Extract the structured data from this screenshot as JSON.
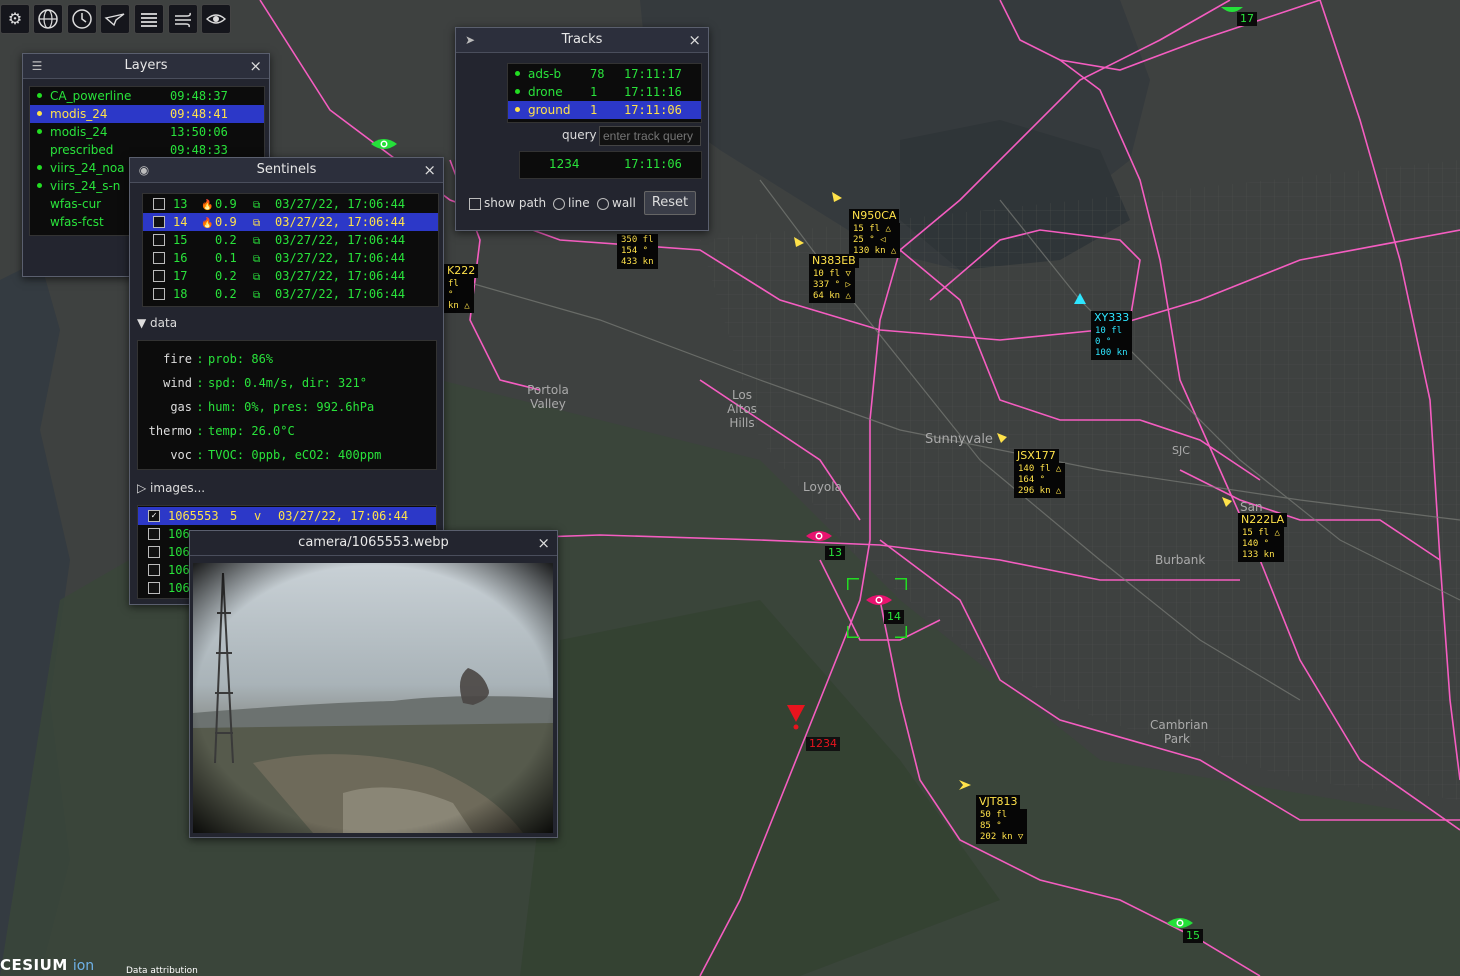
{
  "colors": {
    "accent": "#2c38c8",
    "green_text": "#29e33b",
    "yellow_text": "#ffe24a",
    "cyan_text": "#2ee6ff",
    "powerline": "#ff5fc8",
    "fire_red": "#e8141e"
  },
  "toolbar": {
    "icons": [
      "gear-icon",
      "globe-icon",
      "clock-icon",
      "plane-icon",
      "layers-icon",
      "wind-icon",
      "eye-icon"
    ]
  },
  "layers": {
    "title": "Layers",
    "items": [
      {
        "name": "CA_powerline",
        "time": "09:48:37",
        "dot": "green",
        "selected": false
      },
      {
        "name": "modis_24",
        "time": "09:48:41",
        "dot": "yellow",
        "selected": true
      },
      {
        "name": "modis_24",
        "time": "13:50:06",
        "dot": "green",
        "selected": false
      },
      {
        "name": "prescribed",
        "time": "09:48:33",
        "dot": "none",
        "selected": false
      },
      {
        "name": "viirs_24_noa",
        "time": "",
        "dot": "green",
        "selected": false
      },
      {
        "name": "viirs_24_s-n",
        "time": "",
        "dot": "green",
        "selected": false
      },
      {
        "name": "wfas-cur",
        "time": "",
        "dot": "none",
        "selected": false
      },
      {
        "name": "wfas-fcst",
        "time": "",
        "dot": "none",
        "selected": false
      }
    ]
  },
  "tracks": {
    "title": "Tracks",
    "items": [
      {
        "name": "ads-b",
        "count": "78",
        "time": "17:11:17",
        "selected": false
      },
      {
        "name": "drone",
        "count": "1",
        "time": "17:11:16",
        "selected": false
      },
      {
        "name": "ground",
        "count": "1",
        "time": "17:11:06",
        "selected": true
      }
    ],
    "query_label": "query",
    "query_placeholder": "enter track query",
    "result": {
      "id": "1234",
      "time": "17:11:06"
    },
    "show_path": "show path",
    "line": "line",
    "wall": "wall",
    "reset": "Reset"
  },
  "sentinels": {
    "title": "Sentinels",
    "items": [
      {
        "id": "13",
        "fire": true,
        "value": "0.9",
        "date": "03/27/22, 17:06:44",
        "selected": false
      },
      {
        "id": "14",
        "fire": true,
        "value": "0.9",
        "date": "03/27/22, 17:06:44",
        "selected": true
      },
      {
        "id": "15",
        "fire": false,
        "value": "0.2",
        "date": "03/27/22, 17:06:44",
        "selected": false
      },
      {
        "id": "16",
        "fire": false,
        "value": "0.1",
        "date": "03/27/22, 17:06:44",
        "selected": false
      },
      {
        "id": "17",
        "fire": false,
        "value": "0.2",
        "date": "03/27/22, 17:06:44",
        "selected": false
      },
      {
        "id": "18",
        "fire": false,
        "value": "0.2",
        "date": "03/27/22, 17:06:44",
        "selected": false
      }
    ],
    "data_header": "data",
    "data": [
      {
        "key": "fire",
        "sep": ":",
        "val": "prob: 86%"
      },
      {
        "key": "wind",
        "sep": ":",
        "val": "spd: 0.4m/s, dir: 321°"
      },
      {
        "key": "gas",
        "sep": ":",
        "val": "hum: 0%, pres: 992.6hPa"
      },
      {
        "key": "thermo",
        "sep": ":",
        "val": "temp: 26.0°C"
      },
      {
        "key": "voc",
        "sep": ":",
        "val": "TVOC: 0ppb, eCO2: 400ppm"
      }
    ],
    "images_header": "images...",
    "images": [
      {
        "id": "1065553",
        "n": "5",
        "v": "v",
        "date": "03/27/22, 17:06:44",
        "selected": true
      },
      {
        "id": "106",
        "n": "",
        "v": "",
        "date": "",
        "selected": false
      },
      {
        "id": "106",
        "n": "",
        "v": "",
        "date": "",
        "selected": false
      },
      {
        "id": "106",
        "n": "",
        "v": "",
        "date": "",
        "selected": false
      },
      {
        "id": "106",
        "n": "",
        "v": "",
        "date": "",
        "selected": false
      }
    ]
  },
  "camera": {
    "title": "camera/1065553.webp"
  },
  "aircraft": [
    {
      "callsign": "N950CA",
      "lines": [
        "15 fl △",
        "25 ° ◁",
        "130 kn △"
      ]
    },
    {
      "callsign": "N383EB",
      "lines": [
        "10 fl ▽",
        "337 ° ▷",
        "64 kn △"
      ]
    },
    {
      "callsign": "XY333",
      "lines": [
        "10 fl",
        "0 °",
        "100 kn"
      ]
    },
    {
      "callsign": "JSX177",
      "lines": [
        "140 fl △",
        "164 °",
        "296 kn △"
      ]
    },
    {
      "callsign": "N222LA",
      "lines": [
        "15 fl △",
        "140 °",
        "133 kn"
      ]
    },
    {
      "callsign": "VJT813",
      "lines": [
        "50 fl",
        "85 °",
        "202 kn ▽"
      ]
    },
    {
      "callsign": "",
      "lines": [
        "350 fl",
        "154 °",
        "433 kn"
      ]
    },
    {
      "callsign": "K222",
      "lines": [
        "fl",
        "°",
        "kn △"
      ]
    }
  ],
  "sentinel_markers": [
    "13",
    "14",
    "15",
    "17"
  ],
  "ground_track": "1234",
  "map_labels": [
    "Portola Valley",
    "Los Altos Hills",
    "Loyola",
    "Sunnyvale",
    "Burbank",
    "Cambrian Park",
    "SJC",
    "San"
  ],
  "footer": {
    "brand": "CESIUM",
    "brand2": "ion",
    "attribution": "Data attribution"
  }
}
